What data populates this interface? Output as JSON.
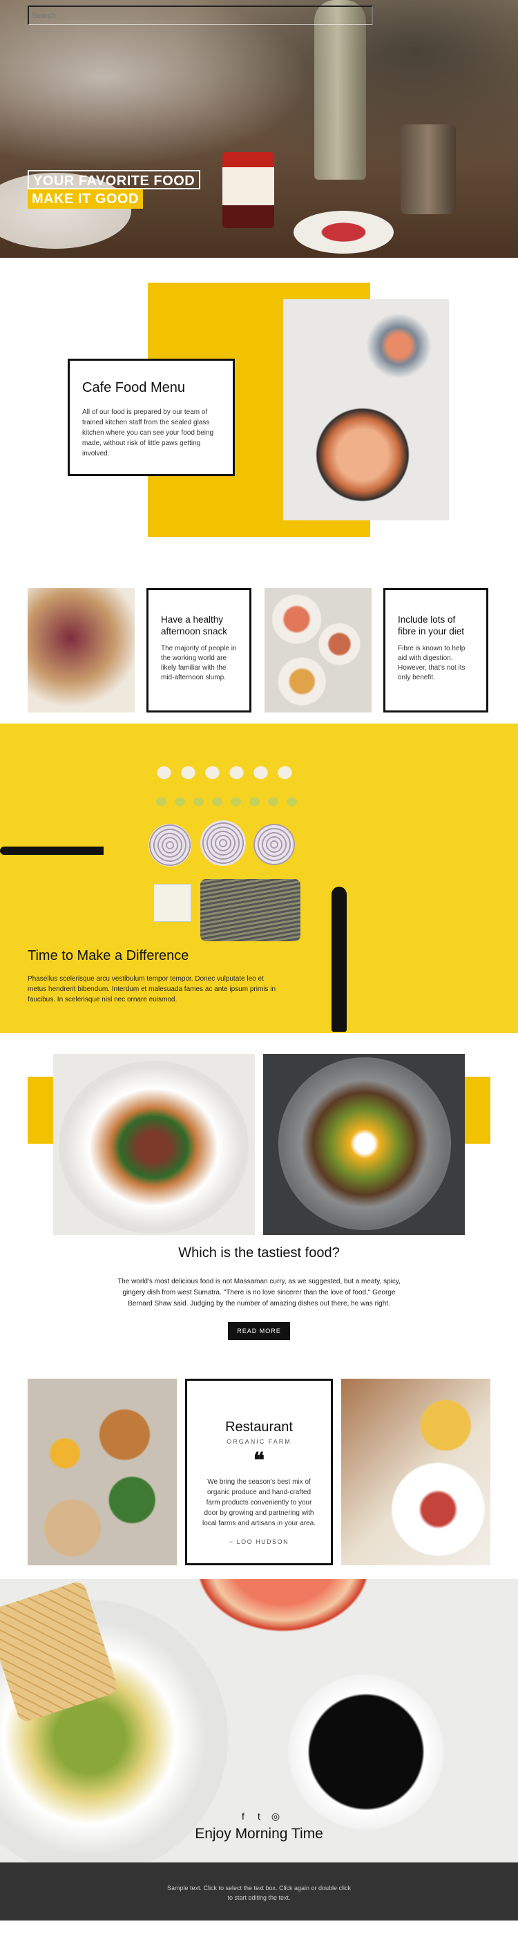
{
  "hero": {
    "search_placeholder": "Search",
    "title_line1": "YOUR FAVORITE FOOD",
    "title_line2": "MAKE IT GOOD"
  },
  "menu": {
    "title": "Cafe Food Menu",
    "text": "All of our food is prepared by our team of trained kitchen staff from the sealed glass kitchen where you can see your food being made, without risk of little paws getting involved."
  },
  "strip": {
    "card1": {
      "title": "Have a healthy afternoon snack",
      "text": "The majority of people in the working world are likely familiar with the mid-afternoon slump."
    },
    "card2": {
      "title": "Include lots of fibre in your diet",
      "text": "Fibre is known to help aid with digestion. However, that's not its only benefit."
    }
  },
  "difference": {
    "title": "Time to Make a Difference",
    "text": "Phasellus scelerisque arcu vestibulum tempor tempor. Donec vulputate leo et metus hendrerit bibendum. Interdum et malesuada fames ac ante ipsum primis in faucibus. In scelerisque nisl nec ornare euismod."
  },
  "tastiest": {
    "title": "Which is the tastiest food?",
    "text": "The world's most delicious food is not Massaman curry, as we suggested, but a meaty, spicy, gingery dish from west Sumatra. \"There is no love sincerer than the love of food,\" George Bernard Shaw said. Judging by the number of amazing dishes out there, he was right.",
    "button": "READ MORE"
  },
  "restaurant": {
    "title": "Restaurant",
    "subtitle": "ORGANIC FARM",
    "quote_mark": "❝",
    "text": "We bring the season's best mix of organic produce and hand-crafted farm products conveniently to your door by growing and partnering with local farms and artisans in your area.",
    "author": "~ LOO HUDSON"
  },
  "morning": {
    "social": {
      "facebook": "f",
      "twitter": "t",
      "instagram": "◎"
    },
    "title": "Enjoy Morning Time"
  },
  "footer": {
    "text": "Sample text. Click to select the text box. Click again or double click to start editing the text."
  },
  "colors": {
    "accent": "#f2c100",
    "dark": "#111111",
    "footer": "#333333"
  }
}
